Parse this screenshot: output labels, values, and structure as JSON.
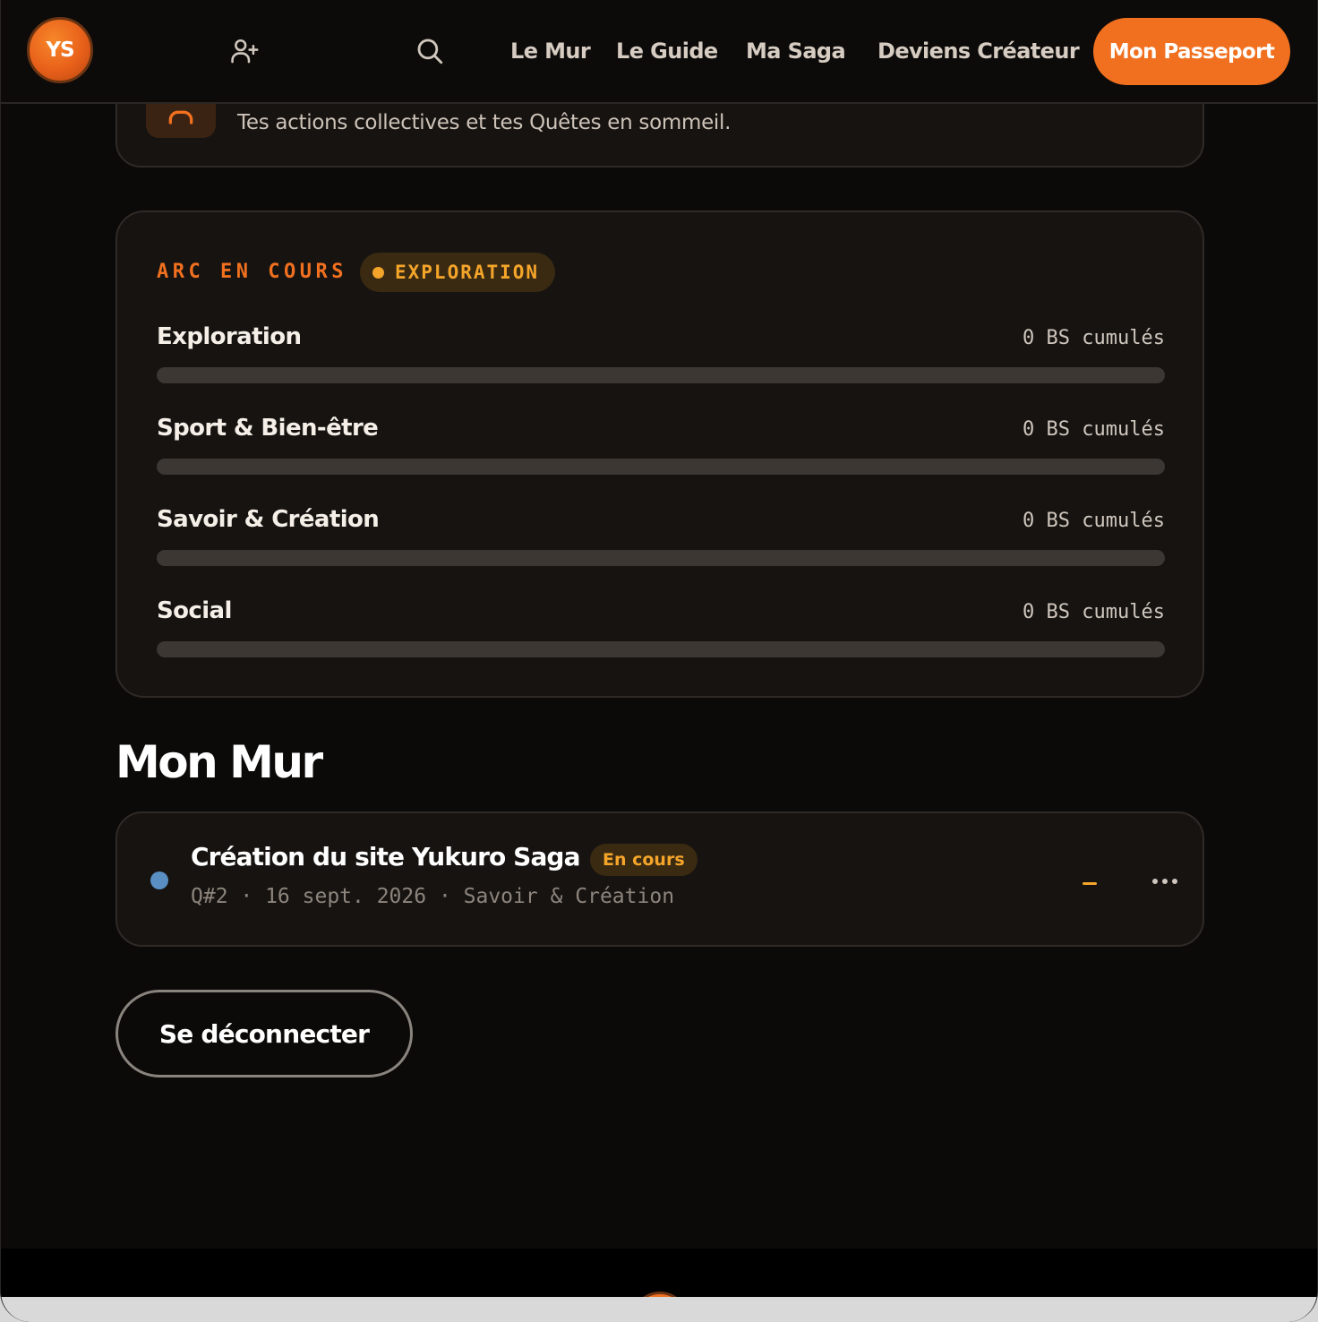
{
  "nav": {
    "avatar_initials": "YS",
    "add_friend_icon": "user-plus-icon",
    "search_icon": "search-icon",
    "links": [
      "Le Mur",
      "Le Guide",
      "Ma Saga",
      "Deviens Créateur"
    ],
    "cta": "Mon Passeport"
  },
  "collective_card": {
    "description": "Tes actions collectives et tes Quêtes en sommeil.",
    "icon": "user-icon"
  },
  "arc": {
    "label": "ARC EN COURS",
    "badge": "EXPLORATION",
    "categories": [
      {
        "name": "Exploration",
        "value_text": "0 BS cumulés",
        "progress": 0
      },
      {
        "name": "Sport & Bien-être",
        "value_text": "0 BS cumulés",
        "progress": 0
      },
      {
        "name": "Savoir & Création",
        "value_text": "0 BS cumulés",
        "progress": 0
      },
      {
        "name": "Social",
        "value_text": "0 BS cumulés",
        "progress": 0
      }
    ]
  },
  "wall": {
    "title": "Mon Mur",
    "quest": {
      "title": "Création du site Yukuro Saga",
      "status": "En cours",
      "meta": "Q#2 · 16 sept. 2026 · Savoir & Création",
      "collapse_icon": "minus-icon",
      "more_icon": "more-horizontal-icon"
    }
  },
  "logout": "Se déconnecter",
  "colors": {
    "accent": "#f0701f",
    "amber": "#f4a52a",
    "background": "#0c0a09",
    "card": "#161311",
    "quest_dot": "#5a8fc4"
  }
}
